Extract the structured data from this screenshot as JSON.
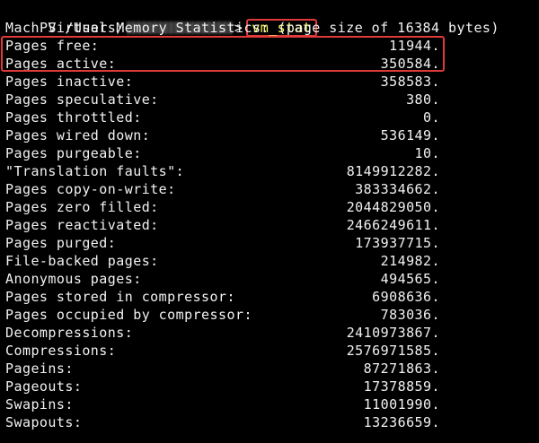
{
  "prompt": {
    "prefix": "PS /Users/",
    "suffix": ">",
    "command": "vm_stat"
  },
  "header": "Mach Virtual Memory Statistics: (page size of 16384 bytes)",
  "highlight_color": "#e03a3a",
  "command_color": "#ffff55",
  "stats": [
    {
      "label": "Pages free:",
      "value": "11944."
    },
    {
      "label": "Pages active:",
      "value": "350584."
    },
    {
      "label": "Pages inactive:",
      "value": "358583."
    },
    {
      "label": "Pages speculative:",
      "value": "380."
    },
    {
      "label": "Pages throttled:",
      "value": "0."
    },
    {
      "label": "Pages wired down:",
      "value": "536149."
    },
    {
      "label": "Pages purgeable:",
      "value": "10."
    },
    {
      "label": "\"Translation faults\":",
      "value": "8149912282."
    },
    {
      "label": "Pages copy-on-write:",
      "value": "383334662."
    },
    {
      "label": "Pages zero filled:",
      "value": "2044829050."
    },
    {
      "label": "Pages reactivated:",
      "value": "2466249611."
    },
    {
      "label": "Pages purged:",
      "value": "173937715."
    },
    {
      "label": "File-backed pages:",
      "value": "214982."
    },
    {
      "label": "Anonymous pages:",
      "value": "494565."
    },
    {
      "label": "Pages stored in compressor:",
      "value": "6908636."
    },
    {
      "label": "Pages occupied by compressor:",
      "value": "783036."
    },
    {
      "label": "Decompressions:",
      "value": "2410973867."
    },
    {
      "label": "Compressions:",
      "value": "2576971585."
    },
    {
      "label": "Pageins:",
      "value": "87271863."
    },
    {
      "label": "Pageouts:",
      "value": "17378859."
    },
    {
      "label": "Swapins:",
      "value": "11001990."
    },
    {
      "label": "Swapouts:",
      "value": "13236659."
    }
  ]
}
